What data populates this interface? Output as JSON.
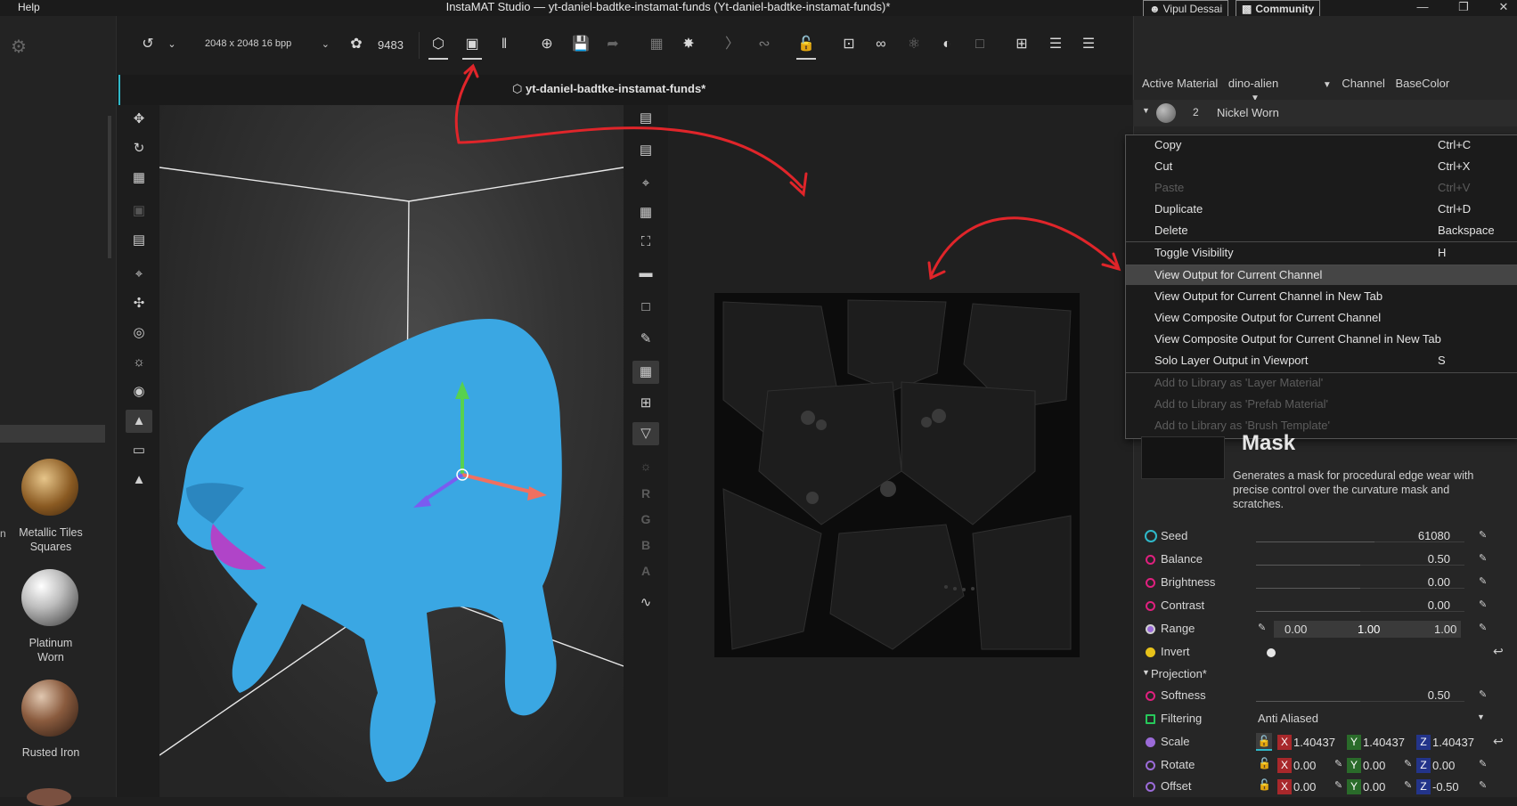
{
  "app": {
    "menu_help": "Help",
    "window_title": "InstaMAT Studio — yt-daniel-badtke-instamat-funds (Yt-daniel-badtke-instamat-funds)*",
    "user": "Vipul Dessai",
    "community": "Community"
  },
  "toolbar": {
    "resolution": "2048 x 2048 16 bpp",
    "count": "9483"
  },
  "document_tab": "yt-daniel-badtke-instamat-funds*",
  "channel_letters": [
    "R",
    "G",
    "B",
    "A"
  ],
  "library": {
    "items": [
      {
        "label_line1": "Metallic Tiles",
        "label_line2": "Squares"
      },
      {
        "label_line1": "Platinum",
        "label_line2": "Worn"
      },
      {
        "label_line1": "Rusted Iron",
        "label_line2": ""
      }
    ]
  },
  "right_panel": {
    "active_material_label": "Active Material",
    "active_material_value": "dino-alien",
    "channel_label": "Channel",
    "channel_value": "BaseColor",
    "layer_index": "2",
    "layer_name": "Nickel Worn"
  },
  "context_menu": {
    "items": [
      {
        "label": "Copy",
        "shortcut": "Ctrl+C"
      },
      {
        "label": "Cut",
        "shortcut": "Ctrl+X"
      },
      {
        "label": "Paste",
        "shortcut": "Ctrl+V"
      },
      {
        "label": "Duplicate",
        "shortcut": "Ctrl+D"
      },
      {
        "label": "Delete",
        "shortcut": "Backspace"
      },
      {
        "label": "Toggle Visibility",
        "shortcut": "H"
      },
      {
        "label": "View Output for Current Channel",
        "shortcut": ""
      },
      {
        "label": "View Output for Current Channel in New Tab",
        "shortcut": ""
      },
      {
        "label": "View Composite Output for Current Channel",
        "shortcut": ""
      },
      {
        "label": "View Composite Output for Current Channel in New Tab",
        "shortcut": ""
      },
      {
        "label": "Solo Layer Output in Viewport",
        "shortcut": "S"
      },
      {
        "label": "Add to Library as 'Layer Material'",
        "shortcut": ""
      },
      {
        "label": "Add to Library as 'Prefab Material'",
        "shortcut": ""
      },
      {
        "label": "Add to Library as 'Brush Template'",
        "shortcut": ""
      }
    ]
  },
  "node": {
    "title": "Mask",
    "description": "Generates a mask for procedural edge wear with precise control over the curvature mask and scratches."
  },
  "properties": {
    "seed": {
      "label": "Seed",
      "value": "61080",
      "fill": 0.57
    },
    "balance": {
      "label": "Balance",
      "value": "0.50",
      "fill": 0.5
    },
    "brightness": {
      "label": "Brightness",
      "value": "0.00",
      "fill": 0.5
    },
    "contrast": {
      "label": "Contrast",
      "value": "0.00",
      "fill": 0.5
    },
    "range": {
      "label": "Range",
      "min": "0.00",
      "mid": "1.00",
      "max": "1.00"
    },
    "invert": {
      "label": "Invert"
    },
    "projection_group": "Projection*",
    "softness": {
      "label": "Softness",
      "value": "0.50",
      "fill": 0.5
    },
    "filtering": {
      "label": "Filtering",
      "value": "Anti Aliased"
    },
    "scale": {
      "label": "Scale",
      "x": "1.40437",
      "y": "1.40437",
      "z": "1.40437"
    },
    "rotate": {
      "label": "Rotate",
      "x": "0.00",
      "y": "0.00",
      "z": "0.00"
    },
    "offset": {
      "label": "Offset",
      "x": "0.00",
      "y": "0.00",
      "z": "-0.50"
    }
  },
  "colors": {
    "accent_cyan": "#2fb8c9",
    "dot_magenta": "#e0207f",
    "dot_yellow": "#e7c21a",
    "dot_purple": "#9b6bd8",
    "dot_green": "#27c85a",
    "annotation_red": "#e0252a",
    "dino_blue": "#3aa7e3"
  }
}
